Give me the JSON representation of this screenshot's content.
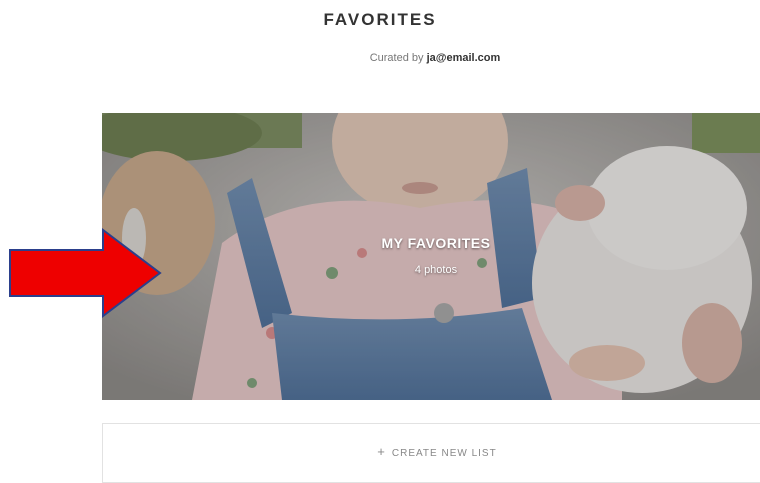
{
  "header": {
    "title": "FAVORITES",
    "curated_prefix": "Curated by",
    "curated_user": "ja@email.com"
  },
  "gallery": {
    "title": "MY FAVORITES",
    "count": "4 photos"
  },
  "actions": {
    "create_label": "CREATE NEW LIST",
    "create_icon": "plus-icon"
  },
  "annotation": {
    "arrow_color": "#ee0000",
    "arrow_border": "#2b3f8c"
  }
}
